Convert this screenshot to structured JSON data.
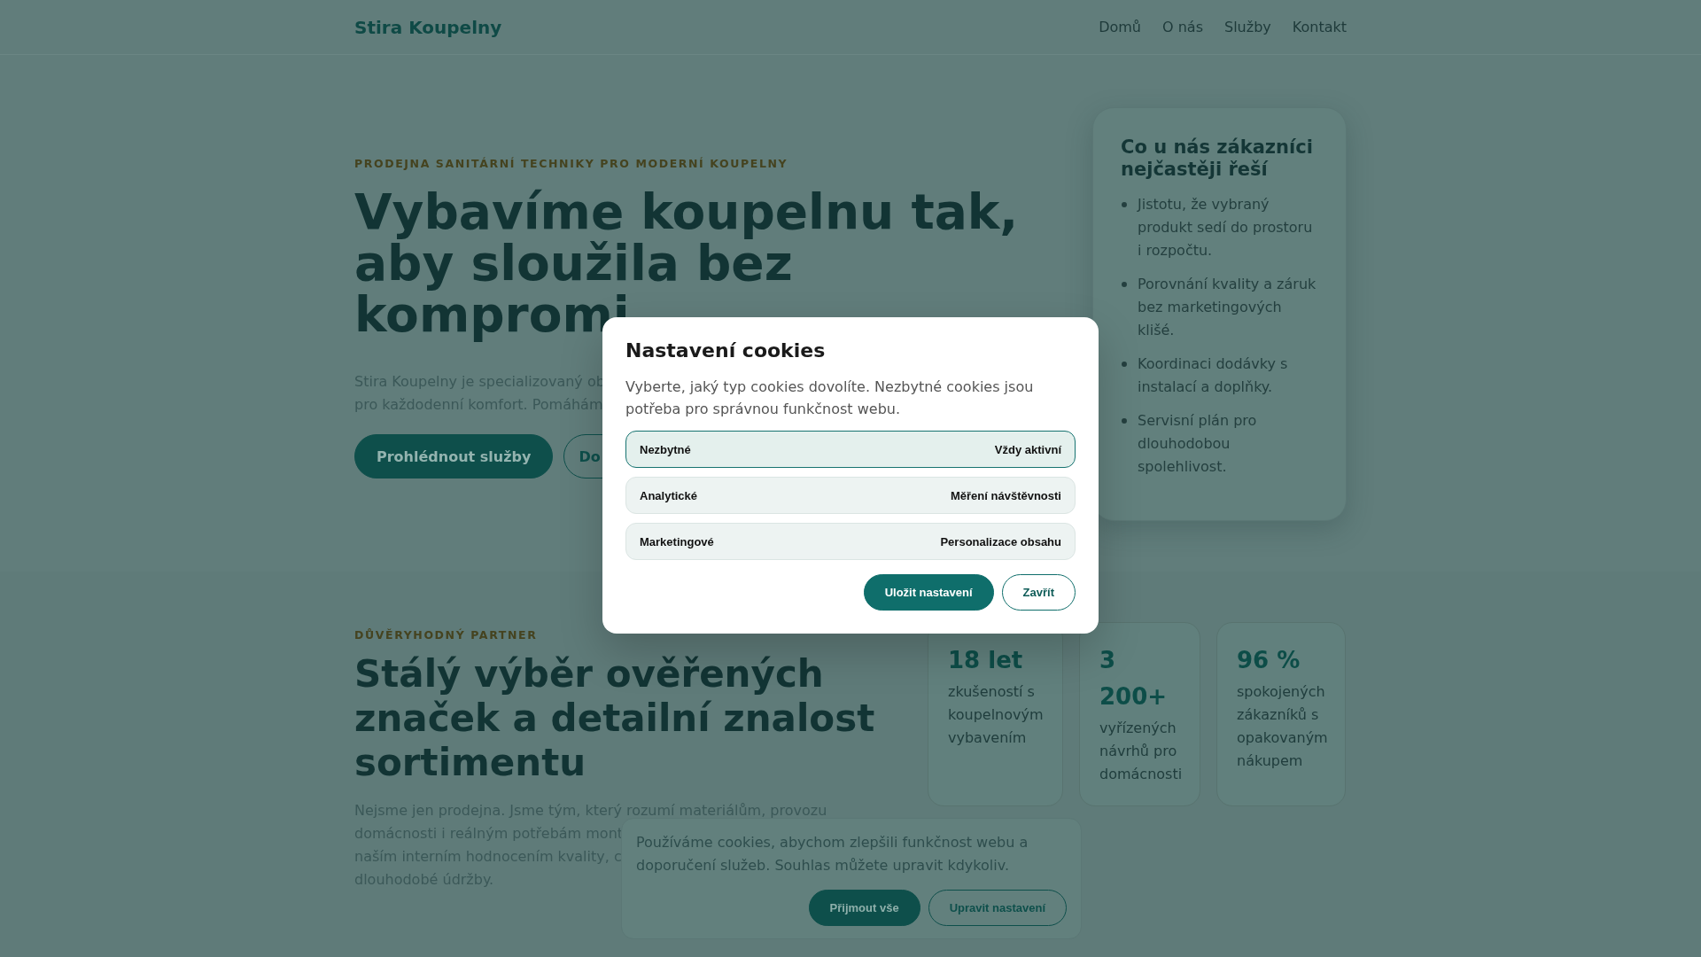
{
  "header": {
    "brand": "Stira Koupelny",
    "nav": [
      {
        "label": "Domů"
      },
      {
        "label": "O nás"
      },
      {
        "label": "Služby"
      },
      {
        "label": "Kontakt"
      }
    ]
  },
  "hero": {
    "eyebrow": "PRODEJNA SANITÁRNÍ TECHNIKY PRO MODERNÍ KOUPELNY",
    "title_lines": [
      "Vybavíme koupelnu tak,",
      "aby sloužila bez",
      "kompromi"
    ],
    "intro_lines": [
      "Stira Koupelny je specializovaný ob",
      "pro každodenní komfort. Pomáhám"
    ],
    "buttons": [
      {
        "label": "Prohlédnout služby",
        "kind": "primary"
      },
      {
        "label": "Do",
        "kind": "outline"
      }
    ]
  },
  "hero_card": {
    "title": "Co u nás zákazníci nejčastěji řeší",
    "items": [
      "Jistotu, že vybraný produkt sedí do prostoru i rozpočtu.",
      "Porovnání kvality a záruk bez marketingových klišé.",
      "Koordinaci dodávky s instalací a doplňky.",
      "Servisní plán pro dlouhodobou spolehlivost."
    ]
  },
  "about": {
    "eyebrow": "DŮVĚRYHODNÝ PARTNER",
    "title": "Stálý výběr ověřených značek a detailní znalost sortimentu",
    "text_lines": [
      "Nejsme jen prodejna. Jsme tým, který rozumí materiálům, provozu",
      "domácnosti i reálným potřebám mont",
      "naším interním hodnocením kvality, c",
      "dlouhodobé údržby."
    ],
    "stats": [
      {
        "value": "18 let",
        "label": "zkušeností s koupelnovým vybavením"
      },
      {
        "value": "3 200+",
        "label": "vyřízených návrhů pro domácnosti"
      },
      {
        "value": "96 %",
        "label": "spokojených zákazníků s opakovaným nákupem"
      }
    ]
  },
  "cookie_banner": {
    "text": "Používáme cookies, abychom zlepšili funkčnost webu a doporučení služeb. Souhlas můžete upravit kdykoliv.",
    "buttons": [
      {
        "label": "Přijmout vše",
        "kind": "primary"
      },
      {
        "label": "Upravit nastavení",
        "kind": "outline"
      }
    ]
  },
  "cookie_modal": {
    "title": "Nastavení cookies",
    "text": "Vyberte, jaký typ cookies dovolíte. Nezbytné cookies jsou potřeba pro správnou funkčnost webu.",
    "categories": [
      {
        "name": "Nezbytné",
        "note": "Vždy aktivní",
        "locked": true
      },
      {
        "name": "Analytické",
        "note": "Měření návštěvnosti",
        "locked": false
      },
      {
        "name": "Marketingové",
        "note": "Personalizace obsahu",
        "locked": false
      }
    ],
    "buttons": [
      {
        "label": "Uložit nastavení",
        "kind": "primary"
      },
      {
        "label": "Zavřít",
        "kind": "outline"
      }
    ]
  }
}
